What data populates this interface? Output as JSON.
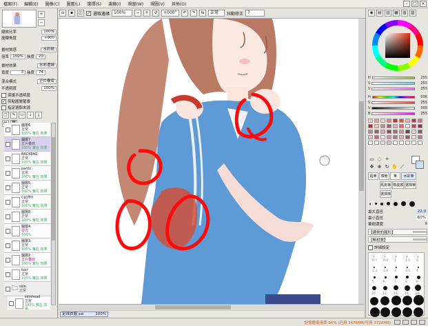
{
  "menu": {
    "items": [
      "檔案(F)",
      "編輯(E)",
      "圖像(C)",
      "圖層(L)",
      "選擇(S)",
      "濾鏡(I)",
      "視窗(W)",
      "視圖(V)",
      "其他(O)"
    ]
  },
  "toolbar": {
    "antialias_label": "選取邊緣",
    "zoom": "100%",
    "angle": "+000°",
    "mode": "正常",
    "stabilizer_label": "抖動修正",
    "stabilizer_value": "7"
  },
  "navigator": {
    "zoom_label": "縮放比率",
    "zoom_value": "100%",
    "angle_label": "旋轉角度",
    "angle_value": "+000"
  },
  "layer_props": {
    "texture_label": "畫材質感",
    "texture_value": "水彩紙",
    "texture_scale_label": "倍率",
    "texture_scale_value": "100%",
    "texture_strength_label": "強度",
    "texture_strength_value": "20",
    "effect_label": "畫材效果",
    "effect_value": "水彩邊緣",
    "width_label": "寬度",
    "width_value": "3",
    "effect_strength_label": "強度",
    "effect_strength_value": "74",
    "blend_label": "混合模式",
    "blend_value": "正片疊底",
    "opacity_label": "不透明度",
    "opacity_value": "100%",
    "options": [
      "保護不透明度",
      "剪貼圖層蒙版",
      "指定選取來源"
    ]
  },
  "layers": [
    {
      "name": "圖層6",
      "mode": "正常",
      "sub": "100% 實在 效果",
      "selected": false
    },
    {
      "name": "圖層7",
      "mode": "正片疊底",
      "sub": "100% 實在 效果",
      "selected": true
    },
    {
      "name": "BACKPAG",
      "mode": "正常",
      "sub": "100% 實在 效果",
      "selected": false
    },
    {
      "name": "pants",
      "mode": "正常",
      "sub": "100% 實在 效果",
      "selected": false
    },
    {
      "name": "圖層5",
      "mode": "正常",
      "sub": "100% 實在 效果",
      "selected": false
    },
    {
      "name": "CLOTH",
      "mode": "正常",
      "sub": "100% 實在 效果",
      "selected": false
    },
    {
      "name": "圖層8",
      "mode": "正常",
      "sub": "100% 實在 效果",
      "selected": false
    },
    {
      "name": "圖層4",
      "mode": "發光",
      "sub": "100%",
      "selected": false
    },
    {
      "name": "圖層3",
      "mode": "正常",
      "sub": "100% 實在 效果",
      "selected": false
    },
    {
      "name": "圖層2",
      "mode": "正片疊底",
      "sub": "100% 實在 效果",
      "selected": false
    },
    {
      "name": "hair",
      "mode": "正常",
      "sub": "100% 實在 效果",
      "selected": false
    },
    {
      "name": "skin",
      "mode": "正常",
      "sub": "",
      "selected": false
    },
    {
      "name": "skinhead",
      "mode": "正常",
      "sub": "100% 實在 效果",
      "selected": false
    },
    {
      "name": "skin",
      "mode": "",
      "sub": "",
      "selected": false
    }
  ],
  "colors": {
    "hsv_h": "255",
    "hsv_s": "255",
    "hsv_v": "255",
    "hue_value": "036",
    "rgb_r": "255",
    "rgb_g": "000",
    "rgb_b": "255",
    "fg": "#ffffff",
    "bg": "#c8dff0"
  },
  "brush": {
    "tabs": [
      "鉛筆",
      "噴槍",
      "筆",
      "水彩筆",
      "馬克筆",
      "橡皮擦",
      "選擇筆",
      "選擇擦"
    ],
    "max_size_label": "最大直徑",
    "max_size_value": "22.0",
    "min_size_label": "最小直徑",
    "min_size_value": "60%",
    "density_label": "筆刷濃度",
    "density_value": "9",
    "shape_label": "【通常的圓形】",
    "texture_label": "【無材質】",
    "detail_label": "詳細設定",
    "size_labels": [
      "0.7",
      "0.8",
      "1",
      "1.5",
      "2",
      "2.3",
      "2.6",
      "3",
      "3.5",
      "4",
      "5",
      "6",
      "7",
      "8",
      "9",
      "10",
      "12",
      "14",
      "16",
      "20",
      "25",
      "30",
      "35",
      "40",
      "50",
      "60",
      "70",
      "80",
      "100",
      "120"
    ]
  },
  "document": {
    "tab_name": "足球衣服.sai",
    "tab_zoom": "100%"
  },
  "status": {
    "text": "記憶體使用率 96% (已用 3678MB/可用 3728MB)"
  }
}
